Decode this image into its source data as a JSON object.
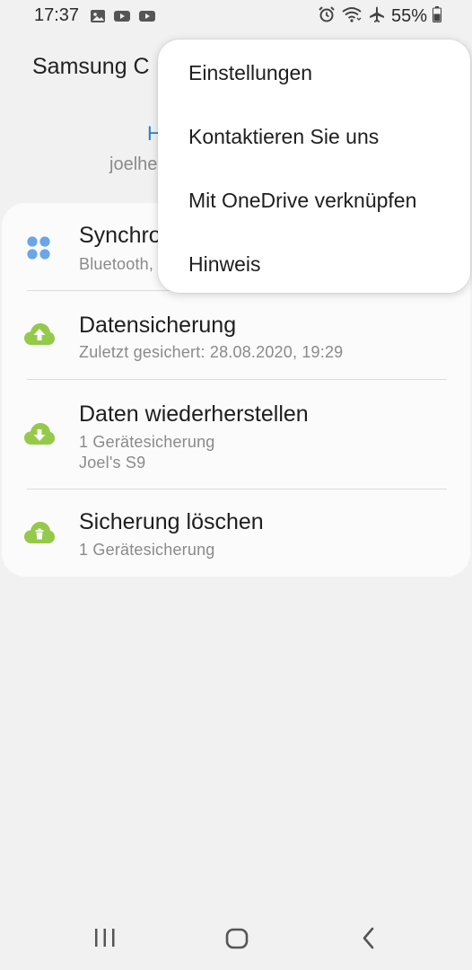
{
  "status_bar": {
    "time": "17:37",
    "battery": "55%",
    "icons": [
      "image-icon",
      "youtube-icon",
      "youtube-icon",
      "alarm-icon",
      "wifi-icon",
      "airplane-icon",
      "battery-icon"
    ]
  },
  "header": {
    "title": "Samsung C",
    "account_name": "H",
    "account_email": "joelhe"
  },
  "items": [
    {
      "title": "Synchro",
      "subtitle": "Bluetooth,",
      "icon": "sync-dots-icon",
      "icon_color": "#6aa6e8"
    },
    {
      "title": "Datensicherung",
      "subtitle": "Zuletzt gesichert: 28.08.2020, 19:29",
      "icon": "cloud-upload-icon",
      "icon_color": "#95c94a"
    },
    {
      "title": "Daten wiederherstellen",
      "subtitle": "1 Gerätesicherung",
      "subtitle2": "Joel's S9",
      "icon": "cloud-download-icon",
      "icon_color": "#95c94a"
    },
    {
      "title": "Sicherung löschen",
      "subtitle": "1 Gerätesicherung",
      "icon": "cloud-delete-icon",
      "icon_color": "#95c94a"
    }
  ],
  "menu": {
    "items": [
      "Einstellungen",
      "Kontaktieren Sie uns",
      "Mit OneDrive verknüpfen",
      "Hinweis"
    ]
  },
  "nav": {
    "icons": [
      "recents-icon",
      "home-icon",
      "back-icon"
    ]
  },
  "colors": {
    "accent": "#2b7de0",
    "green": "#95c94a",
    "blue_dots": "#6aa6e8",
    "background": "#f1f1f1"
  }
}
